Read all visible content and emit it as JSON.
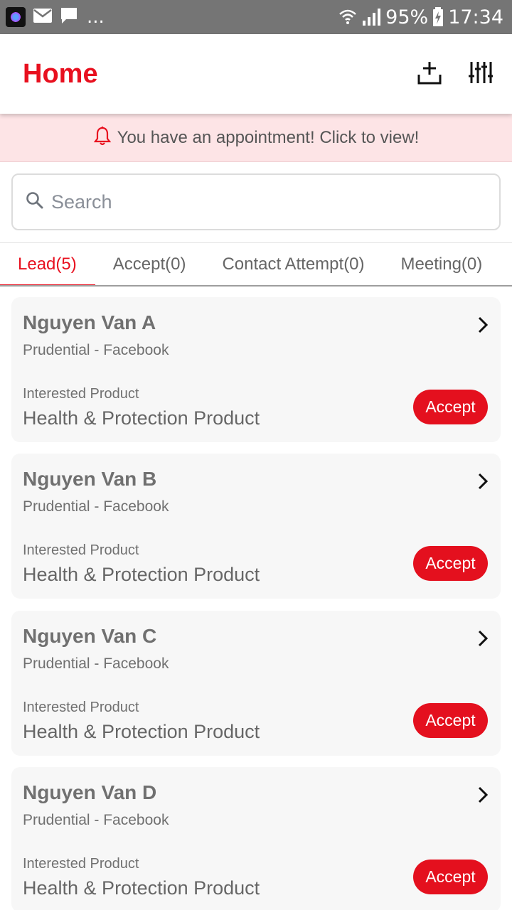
{
  "status_bar": {
    "overflow": "...",
    "battery": "95%",
    "time": "17:34",
    "icons": [
      "app-icon",
      "mail-icon",
      "chat-icon",
      "wifi-icon",
      "signal-icon",
      "battery-charging-icon"
    ]
  },
  "header": {
    "title": "Home",
    "actions": [
      "add-lead-icon",
      "filter-sliders-icon"
    ]
  },
  "banner": {
    "text": "You have an appointment! Click to view!",
    "icon": "bell-icon"
  },
  "search": {
    "placeholder": "Search",
    "value": ""
  },
  "tabs": [
    {
      "label": "Lead(5)",
      "active": true
    },
    {
      "label": "Accept(0)",
      "active": false
    },
    {
      "label": "Contact Attempt(0)",
      "active": false
    },
    {
      "label": "Meeting(0)",
      "active": false
    }
  ],
  "leads": [
    {
      "name": "Nguyen Van A",
      "source": "Prudential - Facebook",
      "interest_label": "Interested Product",
      "product": "Health & Protection Product",
      "action": "Accept"
    },
    {
      "name": "Nguyen Van B",
      "source": "Prudential - Facebook",
      "interest_label": "Interested Product",
      "product": "Health & Protection Product",
      "action": "Accept"
    },
    {
      "name": "Nguyen Van C",
      "source": "Prudential - Facebook",
      "interest_label": "Interested Product",
      "product": "Health & Protection Product",
      "action": "Accept"
    },
    {
      "name": "Nguyen Van D",
      "source": "Prudential - Facebook",
      "interest_label": "Interested Product",
      "product": "Health & Protection Product",
      "action": "Accept"
    }
  ],
  "colors": {
    "accent": "#e8101f",
    "banner_bg": "#fde4e6",
    "card_bg": "#f7f7f7",
    "status_bar_bg": "#757575"
  }
}
